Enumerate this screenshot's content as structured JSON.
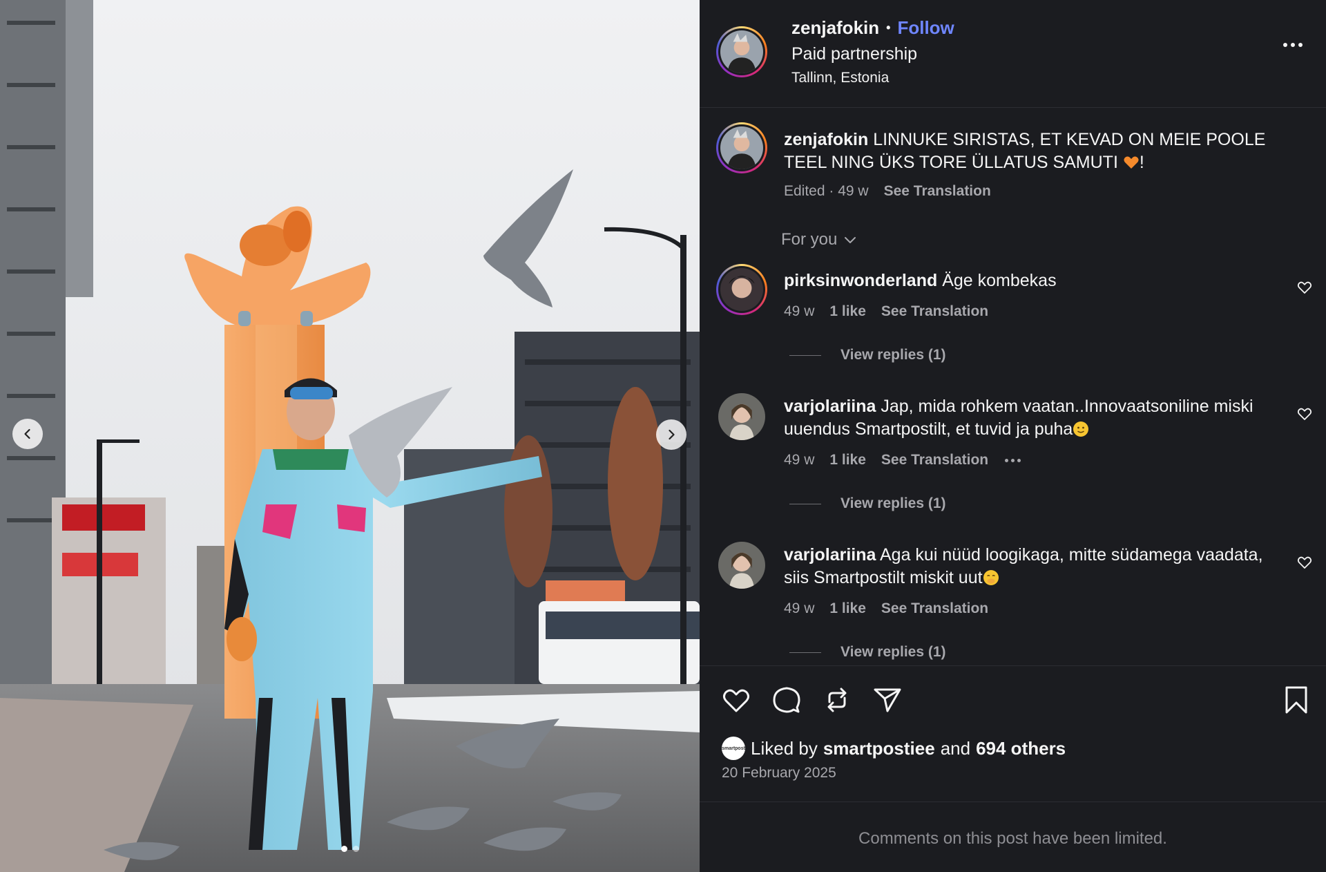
{
  "post": {
    "username": "zenjafokin",
    "separator": "•",
    "follow_label": "Follow",
    "partnership": "Paid partnership",
    "location": "Tallinn, Estonia"
  },
  "caption": {
    "username": "zenjafokin",
    "text_before_emoji": "LINNUKE SIRISTAS, ET KEVAD ON MEIE POOLE TEEL NING ÜKS TORE ÜLLATUS SAMUTI ",
    "emoji": "orange-heart",
    "text_after_emoji": "!",
    "edited": "Edited · 49 w",
    "translation_label": "See Translation"
  },
  "sort": {
    "label": "For you"
  },
  "comments": [
    {
      "username": "pirksinwonderland",
      "text": "Äge kombekas",
      "age": "49 w",
      "likes": "1 like",
      "translation_label": "See Translation",
      "replies_label": "View replies (1)"
    },
    {
      "username": "varjolariina",
      "text": "Jap, mida rohkem vaatan..Innovaatsoniline miski uuendus Smartpostilt, et tuvid ja puha",
      "emoji": "slightly-smiling-face",
      "age": "49 w",
      "likes": "1 like",
      "translation_label": "See Translation",
      "replies_label": "View replies (1)"
    },
    {
      "username": "varjolariina",
      "text": "Aga kui nüüd loogikaga, mitte südamega vaadata, siis Smartpostilt miskit uut",
      "emoji": "face-with-hand-over-mouth",
      "age": "49 w",
      "likes": "1 like",
      "translation_label": "See Translation",
      "replies_label": "View replies (1)"
    }
  ],
  "actions": {
    "like_icon": "heart-icon",
    "comment_icon": "comment-icon",
    "repost_icon": "repost-icon",
    "share_icon": "send-icon",
    "save_icon": "bookmark-icon"
  },
  "likes": {
    "prefix": "Liked by",
    "user": "smartpostiee",
    "conjunction": "and",
    "others": "694 others",
    "avatar_text": "smartpost"
  },
  "date": "20 February 2025",
  "limited_notice": "Comments on this post have been limited.",
  "media": {
    "current_slide": 1,
    "slide_count": 2,
    "colors": {
      "suit": "#8fd3ea",
      "gift": "#f5a15c",
      "sky": "#e9eaed"
    }
  },
  "colors": {
    "background": "#1b1c20",
    "accent": "#6f86ff",
    "muted": "#a8a8ad"
  }
}
